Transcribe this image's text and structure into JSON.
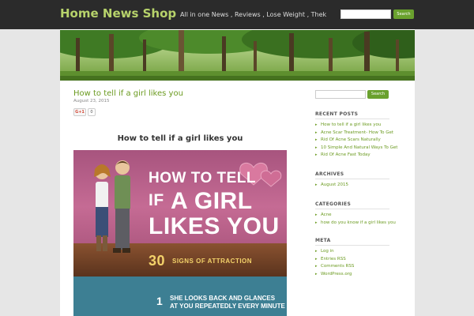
{
  "header": {
    "site_title": "Home News Shop",
    "tagline": "All in one News , Reviews , Lose Weight , Thek",
    "search_button": "Search"
  },
  "post": {
    "title": "How to tell if a girl likes you",
    "date": "August 23, 2015",
    "gplus_label": "G+1",
    "gplus_count": "0",
    "heading": "How to tell if a girl likes you",
    "infographic": {
      "line1": "HOW TO TELL",
      "line2_pre": "IF",
      "line2": "A GIRL",
      "line3": "LIKES YOU",
      "line4": "30",
      "line4_sub": "SIGNS OF ATTRACTION",
      "tip_number": "1",
      "tip_line1": "SHE LOOKS BACK AND GLANCES",
      "tip_line2": "AT YOU REPEATEDLY EVERY MINUTE OR SO"
    }
  },
  "sidebar": {
    "search_button": "Search",
    "recent_posts": {
      "title": "RECENT POSTS",
      "items": [
        "How to tell if a girl likes you",
        "Acne Scar Treatment- How To Get",
        "Rid Of Acne Scars Naturally",
        "10 Simple And Natural Ways To Get",
        "Rid Of Acne Fast Today"
      ]
    },
    "archives": {
      "title": "ARCHIVES",
      "items": [
        "August 2015"
      ]
    },
    "categories": {
      "title": "CATEGORIES",
      "items": [
        "Acne",
        "how do you know if a girl likes you"
      ]
    },
    "meta": {
      "title": "META",
      "items": [
        "Log in",
        "Entries RSS",
        "Comments RSS",
        "WordPress.org"
      ]
    }
  },
  "colors": {
    "accent_green": "#6a9a1f",
    "header_bg": "#2b2b2b",
    "title_green": "#b7d36b",
    "button_green": "#6aa12e"
  }
}
